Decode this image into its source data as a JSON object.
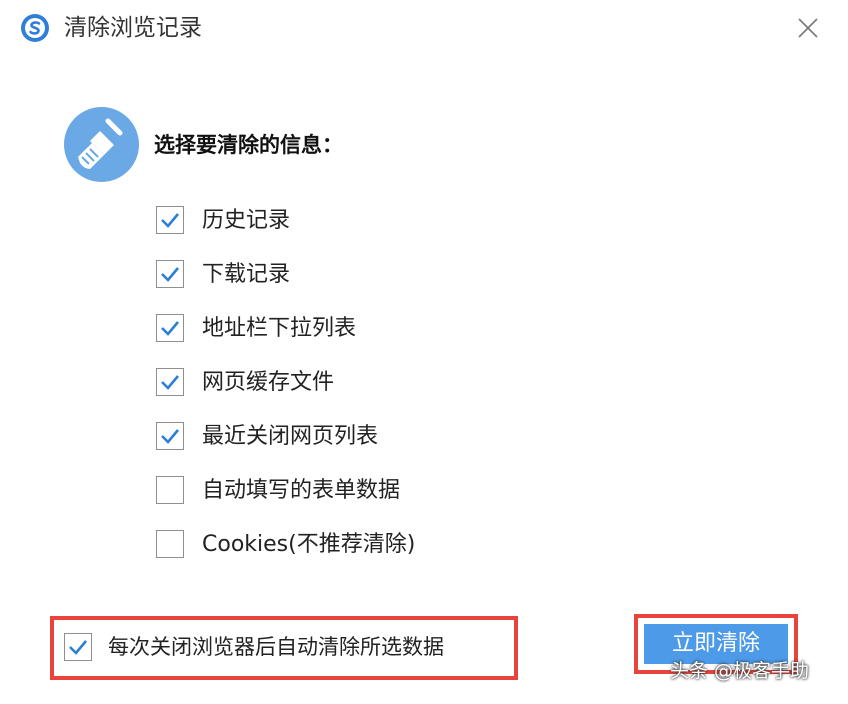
{
  "window": {
    "title": "清除浏览记录",
    "logo_icon": "sogou-browser-logo-icon",
    "close_icon": "close-icon"
  },
  "header": {
    "icon": "broom-icon",
    "heading": "选择要清除的信息："
  },
  "options": [
    {
      "label": "历史记录",
      "checked": true
    },
    {
      "label": "下载记录",
      "checked": true
    },
    {
      "label": "地址栏下拉列表",
      "checked": true
    },
    {
      "label": "网页缓存文件",
      "checked": true
    },
    {
      "label": "最近关闭网页列表",
      "checked": true
    },
    {
      "label": "自动填写的表单数据",
      "checked": false
    },
    {
      "label": "Cookies(不推荐清除)",
      "checked": false
    }
  ],
  "footer": {
    "auto_clear_label": "每次关闭浏览器后自动清除所选数据",
    "auto_clear_checked": true,
    "clear_button_label": "立即清除"
  },
  "watermark": "头条 @极客手助",
  "colors": {
    "accent": "#4c9ae8",
    "badge": "#6aa8e6",
    "highlight": "#e8443c",
    "checkmark": "#2b7fd6"
  }
}
